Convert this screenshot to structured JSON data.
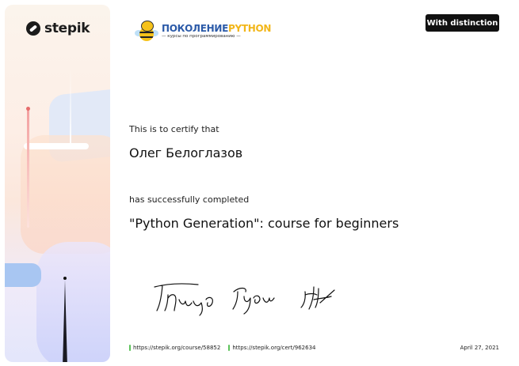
{
  "brand": {
    "stepik_name": "stepik"
  },
  "course_logo": {
    "title_part1": "ПОКОЛЕНИЕ",
    "title_part2": "PYTHON",
    "subtitle": "— курсы по программированию —"
  },
  "badge": "With distinction",
  "certificate": {
    "certify_text": "This is to certify that",
    "recipient_name": "Олег Белоглазов",
    "completed_text": "has successfully completed",
    "course_title": "\"Python Generation\": course for beginners"
  },
  "footer": {
    "course_link": "https://stepik.org/course/58852",
    "cert_link": "https://stepik.org/cert/962634",
    "date": "April 27, 2021"
  },
  "colors": {
    "badge_bg": "#111111",
    "link_marker": "#5cc35a",
    "python_blue": "#2b5aa8",
    "python_yellow": "#f2b619"
  },
  "icons": [
    "stepik-logo-icon",
    "bee-mascot-icon",
    "signature-image"
  ]
}
